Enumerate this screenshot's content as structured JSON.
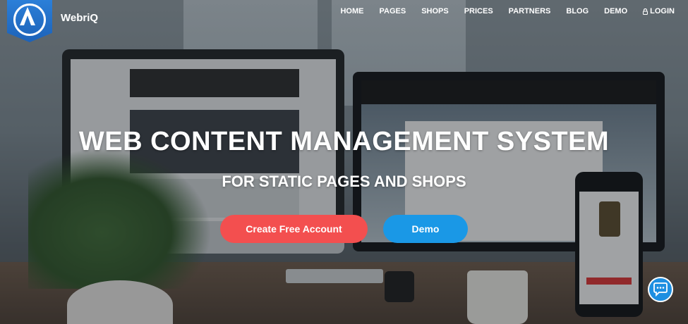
{
  "brand": {
    "name": "WebriQ",
    "logo_icon": "webriq-a-logo-icon",
    "accent": "#1d62b8"
  },
  "nav": {
    "items": [
      {
        "label": "HOME"
      },
      {
        "label": "PAGES"
      },
      {
        "label": "SHOPS"
      },
      {
        "label": "PRICES"
      },
      {
        "label": "PARTNERS"
      },
      {
        "label": "BLOG"
      },
      {
        "label": "DEMO"
      }
    ],
    "login_label": "LOGIN",
    "login_icon": "lock-icon"
  },
  "hero": {
    "title": "WEB CONTENT MANAGEMENT SYSTEM",
    "subtitle": "FOR STATIC PAGES AND SHOPS",
    "primary_button": "Create Free Account",
    "secondary_button": "Demo",
    "primary_color": "#f34f4f",
    "secondary_color": "#1a98e6"
  },
  "chat_widget": {
    "icon": "chat-bubble-icon",
    "color": "#1e8fe1"
  }
}
